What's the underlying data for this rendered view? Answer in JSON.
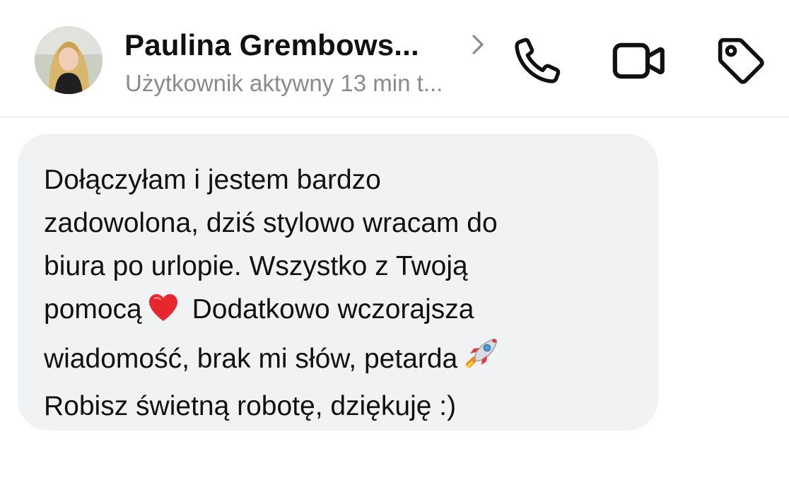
{
  "header": {
    "contact_name": "Paulina Grembows...",
    "status": "Użytkownik aktywny 13 min t...",
    "avatar_alt": "profile-photo",
    "buttons": {
      "call": "phone-icon",
      "video": "video-camera-icon",
      "tag": "tag-icon"
    }
  },
  "message": {
    "lines": [
      "Dołączyłam i jestem bardzo",
      "zadowolona, dziś stylowo wracam do",
      "biura po urlopie. Wszystko z Twoją",
      "pomocą",
      "Dodatkowo wczorajsza",
      "wiadomość, brak mi słów, petarda",
      "Robisz świetną robotę, dziękuję :)"
    ],
    "emojis": {
      "heart": "red-heart-emoji",
      "rocket": "rocket-emoji"
    }
  },
  "colors": {
    "bubble": "#f1f2f4",
    "status_text": "#8a8a8e",
    "heart": "#e8262e"
  }
}
